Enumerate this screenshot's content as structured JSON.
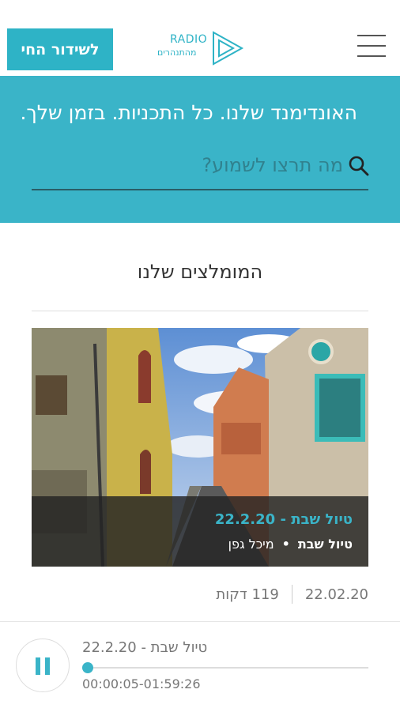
{
  "header": {
    "live_button": "לשידור החי",
    "logo_line1": "RADIO",
    "logo_line2": "מהתנהרים",
    "menu_icon": "hamburger-menu-icon"
  },
  "banner": {
    "title": "האונדימנד שלנו. כל התכניות. בזמן שלך.",
    "search_placeholder": "מה תרצו לשמוע?",
    "search_icon": "search-icon",
    "background": "#3ab4c8"
  },
  "recommended": {
    "title": "המומלצים שלנו",
    "card": {
      "episode_title": "טיול שבת - 22.2.20",
      "program": "טיול שבת",
      "separator": "•",
      "host": "מיכל גפן",
      "date": "22.02.20",
      "duration": "119 דקות"
    }
  },
  "player": {
    "title": "טיול שבת - 22.2.20",
    "time": "00:00:05-01:59:26",
    "progress": 0.0007,
    "state_icon": "pause-icon",
    "accent": "#3ab4c8"
  }
}
